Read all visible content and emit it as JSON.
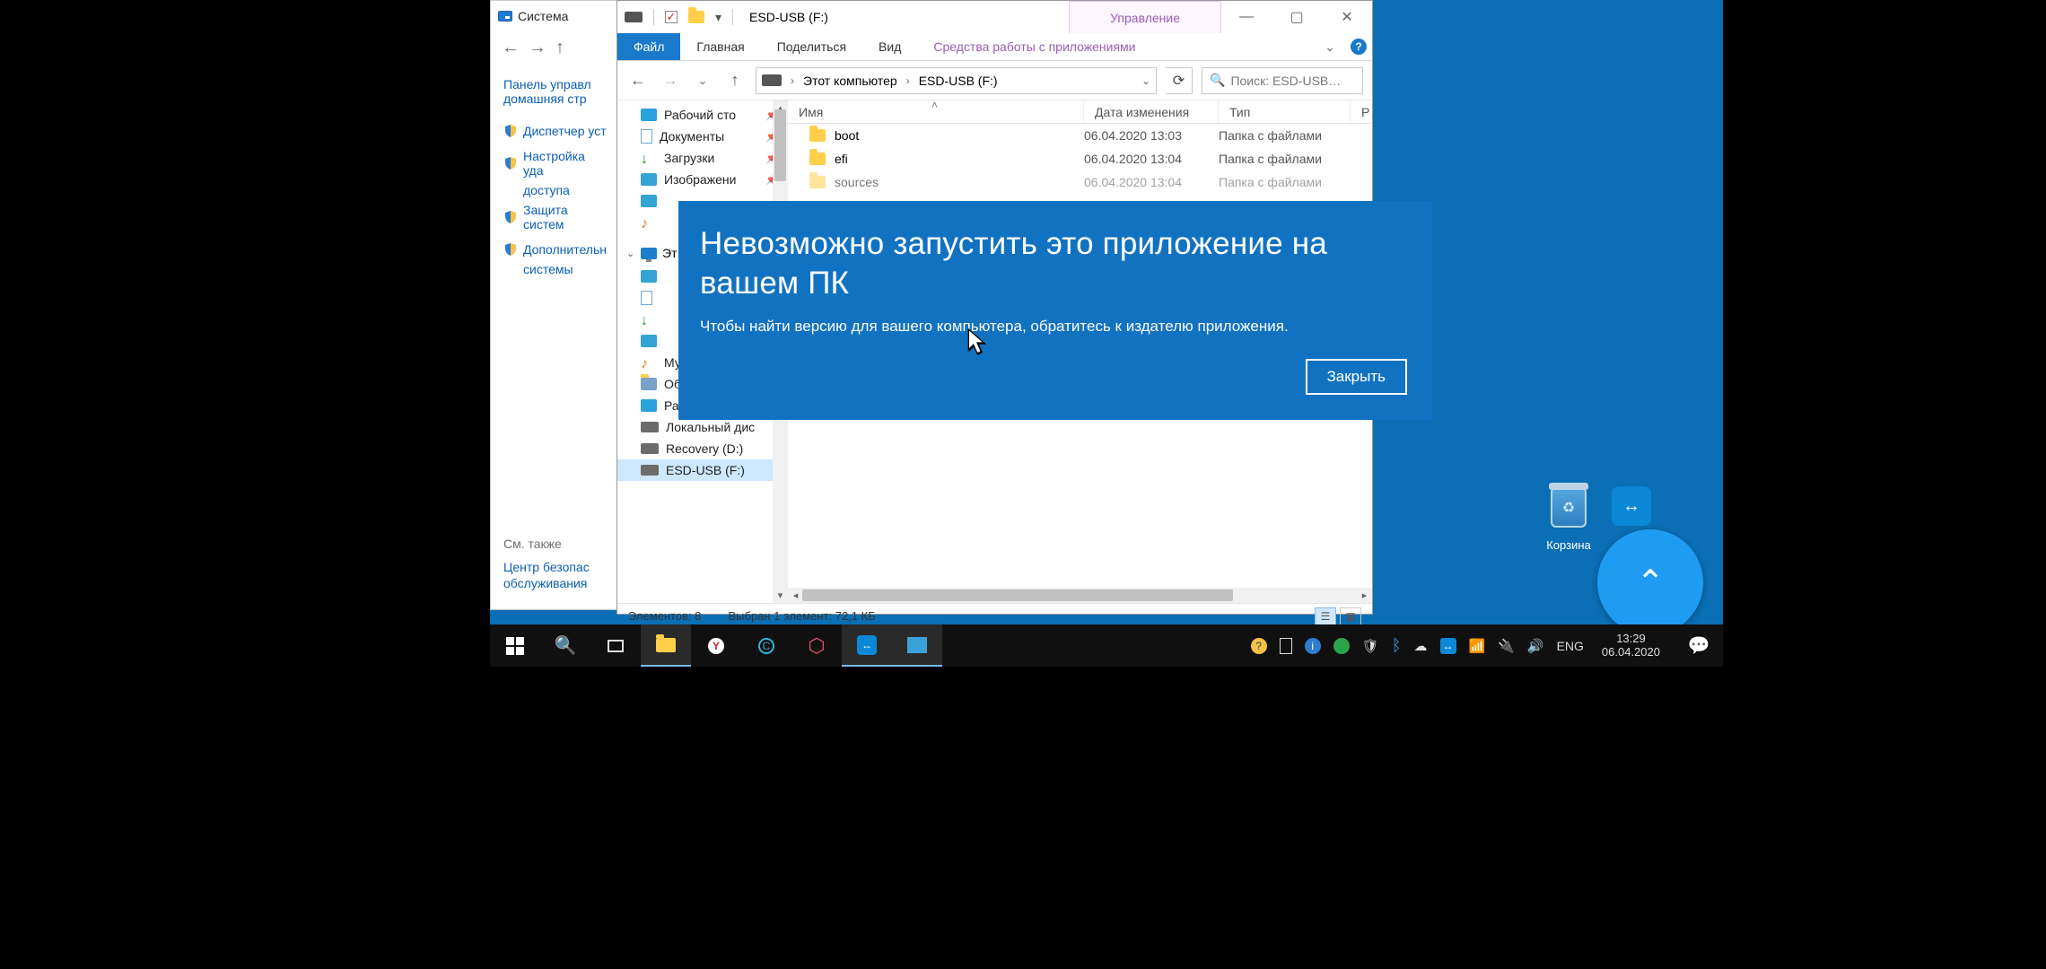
{
  "system_window": {
    "title": "Система",
    "breadcrumb_home": "Панель управл",
    "breadcrumb_home2": "домашняя стр",
    "links": [
      "Диспетчер уст",
      "Настройка уда",
      "доступа",
      "Защита систем",
      "Дополнительн",
      "системы"
    ],
    "see_also_label": "См. также",
    "see_also_link": "Центр безопас",
    "see_also_link2": "обслуживания"
  },
  "explorer": {
    "title": "ESD-USB (F:)",
    "context_tab_header": "Управление",
    "ribbon": {
      "file": "Файл",
      "home": "Главная",
      "share": "Поделиться",
      "view": "Вид",
      "tools": "Средства работы с приложениями"
    },
    "breadcrumb": {
      "root": "Этот компьютер",
      "leaf": "ESD-USB (F:)"
    },
    "search_placeholder": "Поиск: ESD-USB…",
    "columns": {
      "name": "Имя",
      "modified": "Дата изменения",
      "type": "Тип",
      "size": "Р"
    },
    "nav_items": {
      "desktop_q": "Рабочий сто",
      "documents": "Документы",
      "downloads": "Загрузки",
      "pictures": "Изображени",
      "music": "Музыка",
      "volumes": "Объемные объ",
      "desktop": "Рабочий стол",
      "local_disk": "Локальный дис",
      "recovery": "Recovery (D:)",
      "esd": "ESD-USB (F:)",
      "this_pc": "Эт"
    },
    "rows": [
      {
        "name": "boot",
        "date": "06.04.2020 13:03",
        "type": "Папка с файлами"
      },
      {
        "name": "efi",
        "date": "06.04.2020 13:04",
        "type": "Папка с файлами"
      },
      {
        "name": "sources",
        "date": "06.04.2020 13:04",
        "type": "Папка с файлами"
      }
    ],
    "status": {
      "count": "Элементов: 8",
      "selection": "Выбран 1 элемент: 72,1 КБ"
    }
  },
  "error_banner": {
    "title": "Невозможно запустить это приложение на вашем ПК",
    "body": "Чтобы найти версию для вашего компьютера, обратитесь к издателю приложения.",
    "close": "Закрыть"
  },
  "desktop": {
    "recycle": "Корзина"
  },
  "taskbar": {
    "lang": "ENG",
    "time": "13:29",
    "date": "06.04.2020"
  }
}
